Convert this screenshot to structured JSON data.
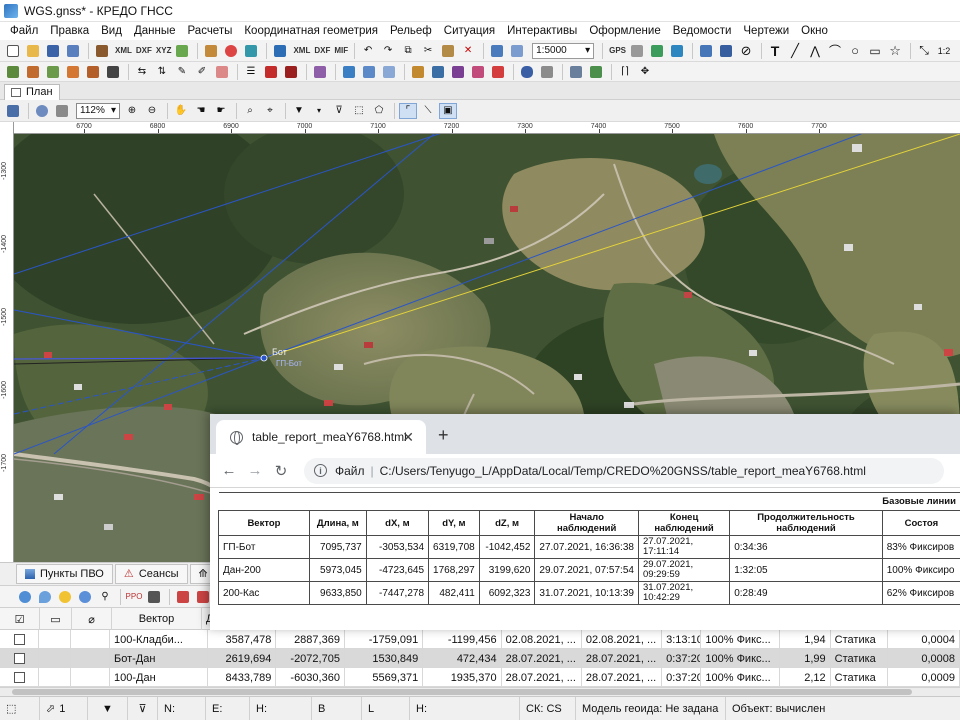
{
  "window": {
    "title": "WGS.gnss* - КРЕДО ГНСС"
  },
  "menu": [
    "Файл",
    "Правка",
    "Вид",
    "Данные",
    "Расчеты",
    "Координатная геометрия",
    "Рельеф",
    "Ситуация",
    "Интерактивы",
    "Оформление",
    "Ведомости",
    "Чертежи",
    "Окно"
  ],
  "toolbar1": {
    "labels": [
      "XML",
      "DXF",
      "XYZ",
      "XML",
      "DXF",
      "MIF"
    ],
    "scale": "1:5000",
    "gps_label": "GPS"
  },
  "plan_tab": {
    "label": "План"
  },
  "map_toolbar": {
    "zoom": "112%"
  },
  "ruler": {
    "top": [
      "6700",
      "6800",
      "6900",
      "7000",
      "7100",
      "7200",
      "7300",
      "7400",
      "7500",
      "7600",
      "7700"
    ],
    "left": [
      "-1300",
      "-1400",
      "-1500",
      "-1600",
      "-1700"
    ]
  },
  "map": {
    "point_label_1": "Бот",
    "point_label_2": "ГП-Бот"
  },
  "panel_tabs": [
    "Пункты ПВО",
    "Сеансы",
    "На"
  ],
  "grid": {
    "headers": [
      "Вектор",
      "Д"
    ],
    "rows": [
      {
        "vector": "100-Кладби...",
        "length": "3587,478",
        "dx": "2887,369",
        "dy": "-1759,091",
        "dz": "-1199,456",
        "start": "02.08.2021, ...",
        "end": "02.08.2021, ...",
        "duration": "3:13:10",
        "status": "100% Фикс...",
        "val": "1,94",
        "type": "Статика",
        "last": "0,0004"
      },
      {
        "vector": "Бот-Дан",
        "length": "2619,694",
        "dx": "-2072,705",
        "dy": "1530,849",
        "dz": "472,434",
        "start": "28.07.2021, ...",
        "end": "28.07.2021, ...",
        "duration": "0:37:20",
        "status": "100% Фикс...",
        "val": "1,99",
        "type": "Статика",
        "last": "0,0008"
      },
      {
        "vector": "100-Дан",
        "length": "8433,789",
        "dx": "-6030,360",
        "dy": "5569,371",
        "dz": "1935,370",
        "start": "28.07.2021, ...",
        "end": "28.07.2021, ...",
        "duration": "0:37:20",
        "status": "100% Фикс...",
        "val": "2,12",
        "type": "Статика",
        "last": "0,0009"
      }
    ]
  },
  "statusbar": {
    "count": "1",
    "n": "N:",
    "e": "E:",
    "h": "H:",
    "b": "B",
    "l": "L",
    "h2": "H:",
    "cs": "СК: CS",
    "geoid": "Модель геоида: Не задана",
    "object": "Объект: вычислен"
  },
  "browser": {
    "tab_title": "table_report_meaY6768.html",
    "url_label": "Файл",
    "url": "C:/Users/Tenyugo_L/AppData/Local/Temp/CREDO%20GNSS/table_report_meaY6768.html"
  },
  "report": {
    "group_title": "Базовые линии",
    "headers": [
      "Вектор",
      "Длина, м",
      "dX, м",
      "dY, м",
      "dZ, м",
      "Начало наблюдений",
      "Конец наблюдений",
      "Продолжительность наблюдений",
      "Состоя"
    ],
    "rows": [
      {
        "vector": "ГП-Бот",
        "length": "7095,737",
        "dx": "-3053,534",
        "dy": "6319,708",
        "dz": "-1042,452",
        "start": "27.07.2021, 16:36:38",
        "end": "27.07.2021, 17:11:14",
        "duration": "0:34:36",
        "state": "83% Фиксиров"
      },
      {
        "vector": "Дан-200",
        "length": "5973,045",
        "dx": "-4723,645",
        "dy": "1768,297",
        "dz": "3199,620",
        "start": "29.07.2021, 07:57:54",
        "end": "29.07.2021, 09:29:59",
        "duration": "1:32:05",
        "state": "100% Фиксиро"
      },
      {
        "vector": "200-Кас",
        "length": "9633,850",
        "dx": "-7447,278",
        "dy": "482,411",
        "dz": "6092,323",
        "start": "31.07.2021, 10:13:39",
        "end": "31.07.2021, 10:42:29",
        "duration": "0:28:49",
        "state": "62% Фиксиров"
      }
    ]
  }
}
